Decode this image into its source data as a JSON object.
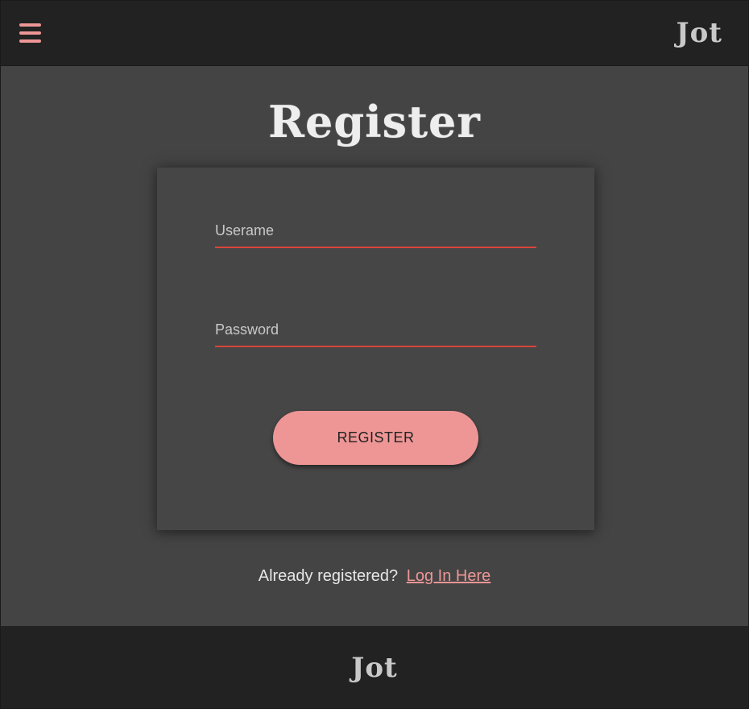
{
  "header": {
    "logo": "Jot",
    "menu_icon": "hamburger-menu-icon"
  },
  "main": {
    "title": "Register",
    "form": {
      "username_label": "Userame",
      "username_value": "",
      "password_label": "Password",
      "password_value": "",
      "submit_label": "REGISTER"
    },
    "login_prompt": "Already registered?",
    "login_link": "Log In Here"
  },
  "footer": {
    "logo": "Jot"
  },
  "colors": {
    "accent": "#ee9696",
    "underline": "#d9443a",
    "background": "#444444",
    "bar": "#222222"
  }
}
